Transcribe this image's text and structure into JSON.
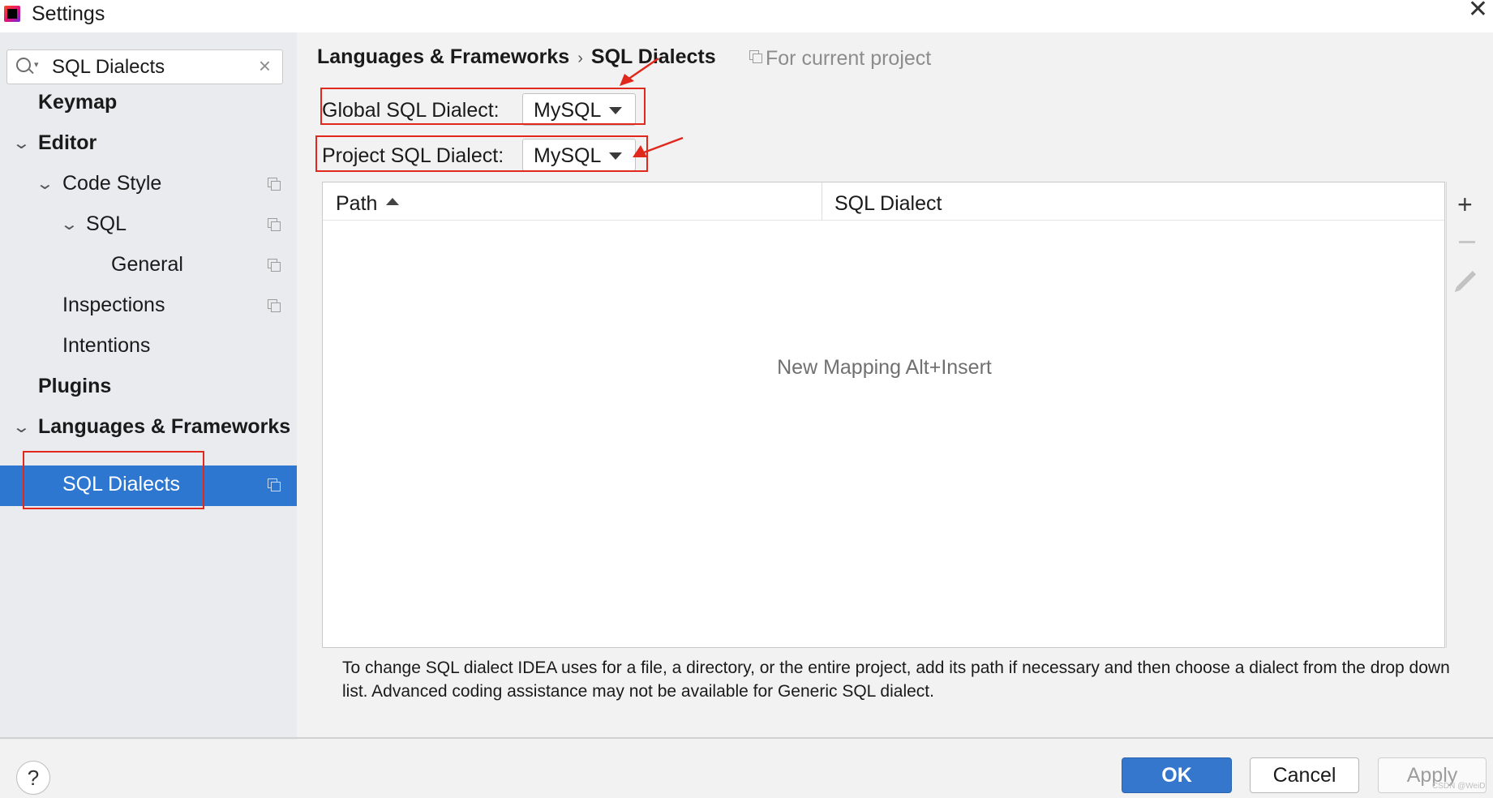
{
  "window": {
    "title": "Settings"
  },
  "sidebar": {
    "search": {
      "value": "SQL Dialects",
      "placeholder": ""
    },
    "items": [
      {
        "label": "Keymap"
      },
      {
        "label": "Editor"
      },
      {
        "label": "Code Style"
      },
      {
        "label": "SQL"
      },
      {
        "label": "General"
      },
      {
        "label": "Inspections"
      },
      {
        "label": "Intentions"
      },
      {
        "label": "Plugins"
      },
      {
        "label": "Languages & Frameworks"
      },
      {
        "label": "SQL Dialects"
      }
    ],
    "selected": "SQL Dialects"
  },
  "main": {
    "breadcrumb": {
      "parent": "Languages & Frameworks",
      "separator": "›",
      "current": "SQL Dialects"
    },
    "scope_note": "For current project",
    "global_dialect": {
      "label": "Global SQL Dialect:",
      "value": "MySQL"
    },
    "project_dialect": {
      "label": "Project SQL Dialect:",
      "value": "MySQL"
    },
    "table": {
      "columns": [
        "Path",
        "SQL Dialect"
      ],
      "sorted_column": "Path",
      "sort_direction": "ascending",
      "empty_text": "New Mapping Alt+Insert"
    },
    "toolbar": {
      "add_icon": "plus-icon",
      "remove_icon": "minus-icon",
      "edit_icon": "pencil-icon"
    },
    "help_text": "To change SQL dialect IDEA uses for a file, a directory, or the entire project, add its path if necessary and then choose a dialect from the drop down list. Advanced coding assistance may not be available for Generic SQL dialect."
  },
  "footer": {
    "help_label": "?",
    "ok_label": "OK",
    "cancel_label": "Cancel",
    "apply_label": "Apply",
    "watermark": "CSDN @WeiD"
  },
  "colors": {
    "accent": "#2d77d0",
    "ok_button": "#3577cc",
    "annotation": "#e0281c",
    "sidebar_bg": "#e9ebee",
    "panel_bg": "#f2f2f2"
  }
}
